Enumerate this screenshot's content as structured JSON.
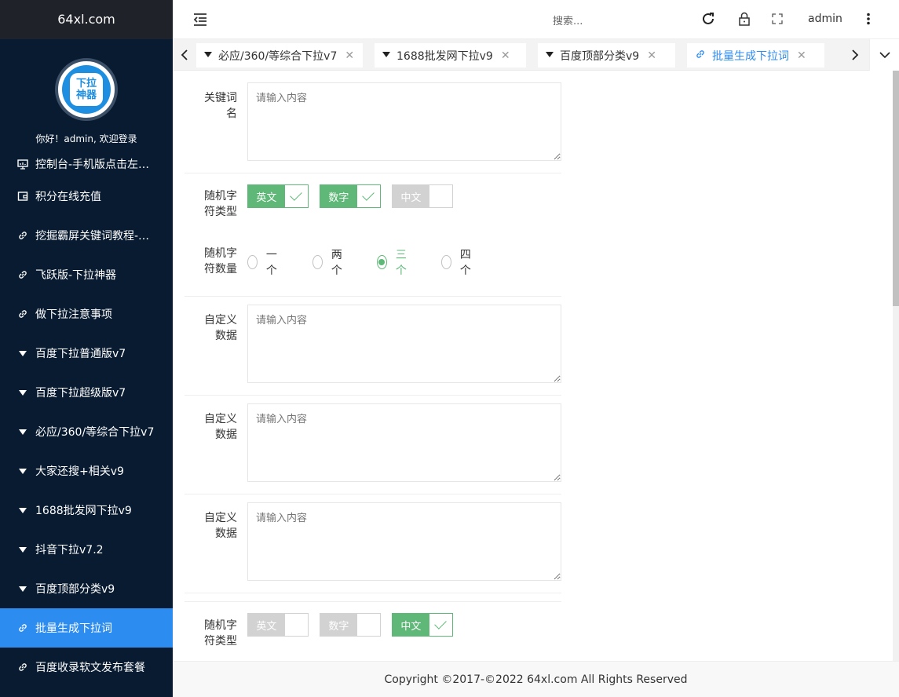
{
  "brand": "64xl.com",
  "sidebar": {
    "avatar_text": [
      "下拉",
      "神器"
    ],
    "welcome": "你好！admin, 欢迎登录",
    "items": [
      {
        "label": "控制台-手机版点击左…",
        "icon": "monitor-icon"
      },
      {
        "label": "积分在线充值",
        "icon": "wallet-icon"
      },
      {
        "label": "挖掘霸屏关键词教程-…",
        "icon": "link-icon"
      },
      {
        "label": "飞跃版-下拉神器",
        "icon": "link-icon"
      },
      {
        "label": "做下拉注意事项",
        "icon": "link-icon"
      },
      {
        "label": "百度下拉普通版v7",
        "icon": "triangle-down-icon"
      },
      {
        "label": "百度下拉超级版v7",
        "icon": "triangle-down-icon"
      },
      {
        "label": "必应/360/等综合下拉v7",
        "icon": "triangle-down-icon"
      },
      {
        "label": "大家还搜+相关v9",
        "icon": "triangle-down-icon"
      },
      {
        "label": "1688批发网下拉v9",
        "icon": "triangle-down-icon"
      },
      {
        "label": "抖音下拉v7.2",
        "icon": "triangle-down-icon"
      },
      {
        "label": "百度顶部分类v9",
        "icon": "triangle-down-icon"
      },
      {
        "label": "批量生成下拉词",
        "icon": "link-icon",
        "active": true
      },
      {
        "label": "百度收录软文发布套餐",
        "icon": "link-icon"
      }
    ]
  },
  "header": {
    "search_placeholder": "搜索...",
    "user": "admin"
  },
  "tabs": [
    {
      "label": "必应/360/等综合下拉v7",
      "icon": "triangle-down-icon"
    },
    {
      "label": "1688批发网下拉v9",
      "icon": "triangle-down-icon"
    },
    {
      "label": "百度顶部分类v9",
      "icon": "triangle-down-icon"
    },
    {
      "label": "批量生成下拉词",
      "icon": "link-icon",
      "active": true
    }
  ],
  "form": {
    "keyword_label": "关键词名",
    "placeholder": "请输入内容",
    "random_type_label": "随机字符类型",
    "random_count_label": "随机字符数量",
    "custom_label": "自定义数据",
    "switches_1": [
      {
        "label": "英文",
        "on": true
      },
      {
        "label": "数字",
        "on": true
      },
      {
        "label": "中文",
        "on": false
      }
    ],
    "radios": [
      {
        "label": "一个",
        "checked": false
      },
      {
        "label": "两个",
        "checked": false
      },
      {
        "label": "三个",
        "checked": true
      },
      {
        "label": "四个",
        "checked": false
      }
    ],
    "switches_2": [
      {
        "label": "英文",
        "on": false
      },
      {
        "label": "数字",
        "on": false
      },
      {
        "label": "中文",
        "on": true
      }
    ]
  },
  "footer": "Copyright ©2017-©2022 64xl.com All Rights Reserved",
  "colors": {
    "sidebar": "#081b31",
    "active": "#2d8cf0",
    "green": "#5fb878"
  }
}
